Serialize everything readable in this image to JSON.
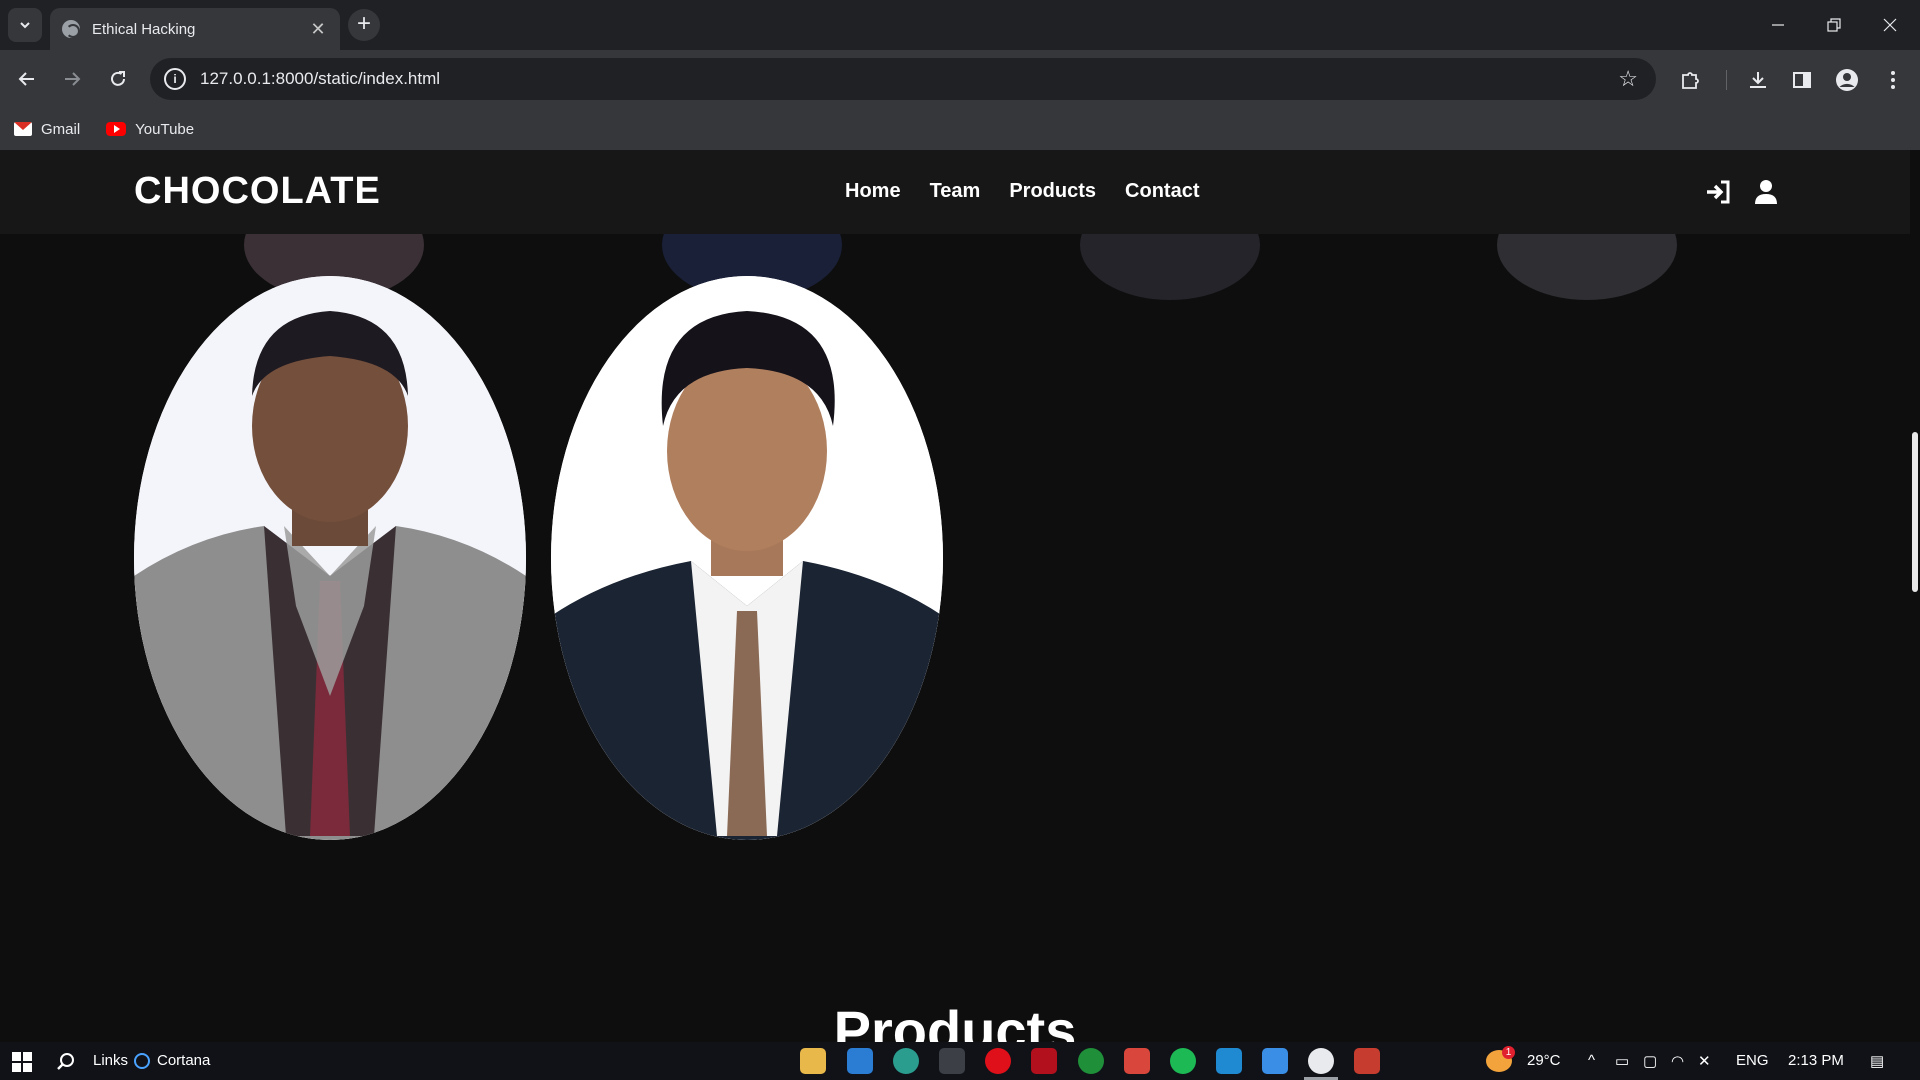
{
  "browser": {
    "tab_title": "Ethical Hacking",
    "tab_close": "✕",
    "new_tab": "+",
    "url": "127.0.0.1:8000/static/index.html",
    "bookmarks": [
      {
        "label": "Gmail",
        "icon": "gmail-icon"
      },
      {
        "label": "YouTube",
        "icon": "youtube-icon"
      }
    ]
  },
  "site": {
    "brand": "CHOCOLATE",
    "nav": [
      "Home",
      "Team",
      "Products",
      "Contact"
    ],
    "header_icons": [
      "login-icon",
      "user-icon"
    ],
    "section_title": "Products",
    "colors": {
      "background": "#0e0e0e",
      "header": "#171717",
      "text": "#ffffff"
    }
  },
  "team_photos": [
    {
      "name": "team-member-photo-1",
      "suit": "#8e8e8e"
    },
    {
      "name": "team-member-photo-2",
      "suit": "#1b2433"
    }
  ],
  "taskbar": {
    "links_label": "Links",
    "cortana_label": "Cortana",
    "weather": "29°C",
    "language": "ENG",
    "time": "2:13 PM",
    "weather_badge": "1"
  }
}
